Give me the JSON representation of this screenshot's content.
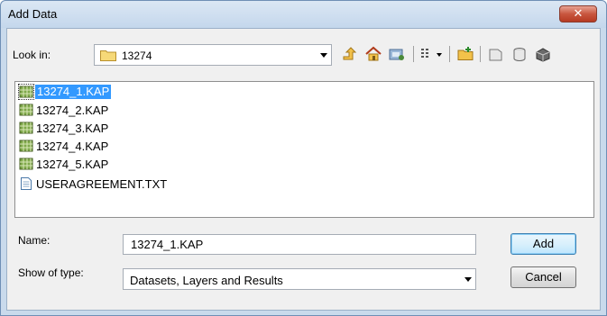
{
  "window": {
    "title": "Add Data",
    "close_label": "✕"
  },
  "lookin": {
    "label": "Look in:",
    "value": "13274"
  },
  "toolbar": {
    "icons": [
      "up-one-level-icon",
      "home-icon",
      "connect-to-folder-icon",
      "view-details-icon",
      "new-folder-icon",
      "new-geodatabase-icon",
      "new-shapefile-icon",
      "new-toolbox-icon"
    ]
  },
  "files": [
    {
      "name": "13274_1.KAP",
      "type": "raster",
      "selected": true
    },
    {
      "name": "13274_2.KAP",
      "type": "raster",
      "selected": false
    },
    {
      "name": "13274_3.KAP",
      "type": "raster",
      "selected": false
    },
    {
      "name": "13274_4.KAP",
      "type": "raster",
      "selected": false
    },
    {
      "name": "13274_5.KAP",
      "type": "raster",
      "selected": false
    },
    {
      "name": "USERAGREEMENT.TXT",
      "type": "text",
      "selected": false
    }
  ],
  "name_field": {
    "label": "Name:",
    "value": "13274_1.KAP"
  },
  "type_field": {
    "label": "Show of type:",
    "value": "Datasets, Layers and Results"
  },
  "buttons": {
    "add": "Add",
    "cancel": "Cancel"
  },
  "colors": {
    "selection": "#3399ff",
    "titlebar": "#c4d7ec",
    "close": "#c8563f"
  }
}
